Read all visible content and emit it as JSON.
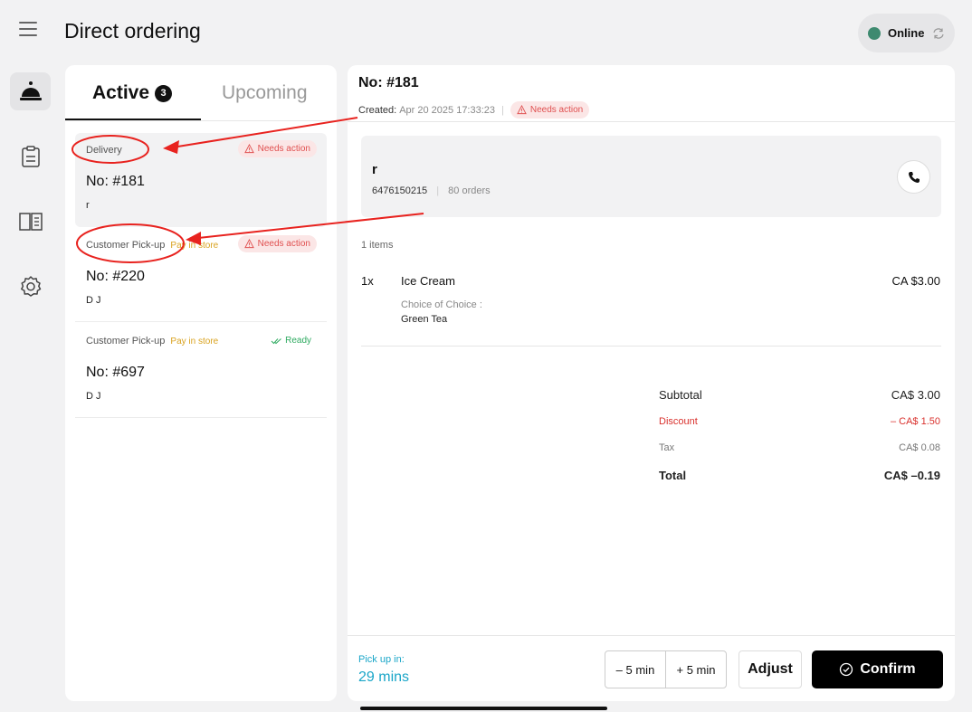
{
  "header": {
    "title": "Direct ordering",
    "status": "Online",
    "status_color": "#3e8a70"
  },
  "nav": {
    "items": [
      {
        "icon": "bell-icon",
        "active": true
      },
      {
        "icon": "clipboard-icon",
        "active": false
      },
      {
        "icon": "menu-book-icon",
        "active": false
      },
      {
        "icon": "gear-icon",
        "active": false
      }
    ]
  },
  "tabs": {
    "active_label": "Active",
    "active_count": "3",
    "upcoming_label": "Upcoming"
  },
  "orders": [
    {
      "type": "Delivery",
      "payment": "",
      "badge": "Needs action",
      "number": "No: #181",
      "customer": "r"
    },
    {
      "type": "Customer Pick-up",
      "payment": "Pay in store",
      "badge": "Needs action",
      "number": "No: #220",
      "customer": "D J"
    },
    {
      "type": "Customer Pick-up",
      "payment": "Pay in store",
      "badge": "Ready",
      "number": "No: #697",
      "customer": "D J"
    }
  ],
  "detail": {
    "number": "No: #181",
    "created_label": "Created:",
    "created_value": "Apr 20 2025 17:33:23",
    "badge": "Needs action",
    "customer_name": "r",
    "customer_phone": "6476150215",
    "customer_orders": "80 orders",
    "item_count": "1 items",
    "items": [
      {
        "qty": "1x",
        "name": "Ice Cream",
        "price": "CA $3.00",
        "option_label": "Choice of Choice :",
        "option_value": "Green Tea"
      }
    ],
    "summary": {
      "subtotal_label": "Subtotal",
      "subtotal_value": "CA$ 3.00",
      "discount_label": "Discount",
      "discount_value": "– CA$ 1.50",
      "tax_label": "Tax",
      "tax_value": "CA$ 0.08",
      "total_label": "Total",
      "total_value": "CA$ –0.19"
    },
    "pickup_label": "Pick up in:",
    "pickup_value": "29 mins",
    "minus_label": "– 5 min",
    "plus_label": "+ 5 min",
    "adjust_label": "Adjust",
    "confirm_label": "Confirm"
  },
  "colors": {
    "accent_cyan": "#1aa6c8",
    "needs_action_red": "#e05050",
    "ready_green": "#2eaa60",
    "pay_yellow": "#d9a21e",
    "annotation_red": "#e8231f"
  }
}
